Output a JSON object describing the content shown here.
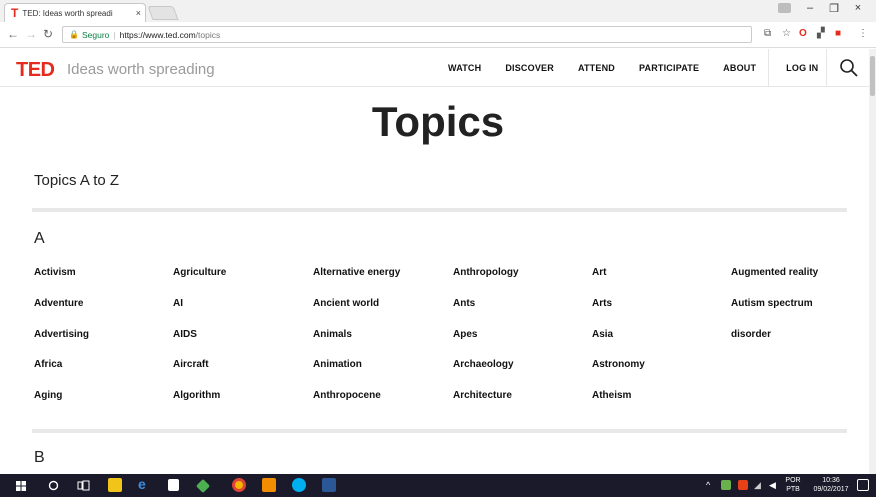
{
  "browser": {
    "tab_title": "TED: Ideas worth spreadi",
    "tab_close": "×",
    "favicon": "T",
    "secure_label": "Seguro",
    "url_host": "https://www.ted.com",
    "url_path": "/topics",
    "url_sep": "|",
    "win_minimize": "–",
    "win_restore": "❐",
    "win_close": "×"
  },
  "header": {
    "logo": "TED",
    "tagline": "Ideas worth spreading",
    "nav": [
      "WATCH",
      "DISCOVER",
      "ATTEND",
      "PARTICIPATE",
      "ABOUT"
    ],
    "login": "LOG IN"
  },
  "page": {
    "title": "Topics",
    "subtitle": "Topics A to Z",
    "sections": [
      {
        "letter": "A",
        "columns": [
          [
            "Activism",
            "Adventure",
            "Advertising",
            "Africa",
            "Aging"
          ],
          [
            "Agriculture",
            "AI",
            "AIDS",
            "Aircraft",
            "Algorithm"
          ],
          [
            "Alternative energy",
            "Ancient world",
            "Animals",
            "Animation",
            "Anthropocene"
          ],
          [
            "Anthropology",
            "Ants",
            "Apes",
            "Archaeology",
            "Architecture"
          ],
          [
            "Art",
            "Arts",
            "Asia",
            "Astronomy",
            "Atheism"
          ],
          [
            "Augmented reality",
            "Autism spectrum",
            "disorder"
          ]
        ]
      },
      {
        "letter": "B"
      }
    ]
  },
  "taskbar": {
    "lang_top": "POR",
    "lang_bottom": "PTB",
    "time": "10:36",
    "date": "09/02/2017"
  },
  "colors": {
    "ted_red": "#e62b1e",
    "secure_green": "#0b8043",
    "taskbar": "#1a1a2a"
  }
}
